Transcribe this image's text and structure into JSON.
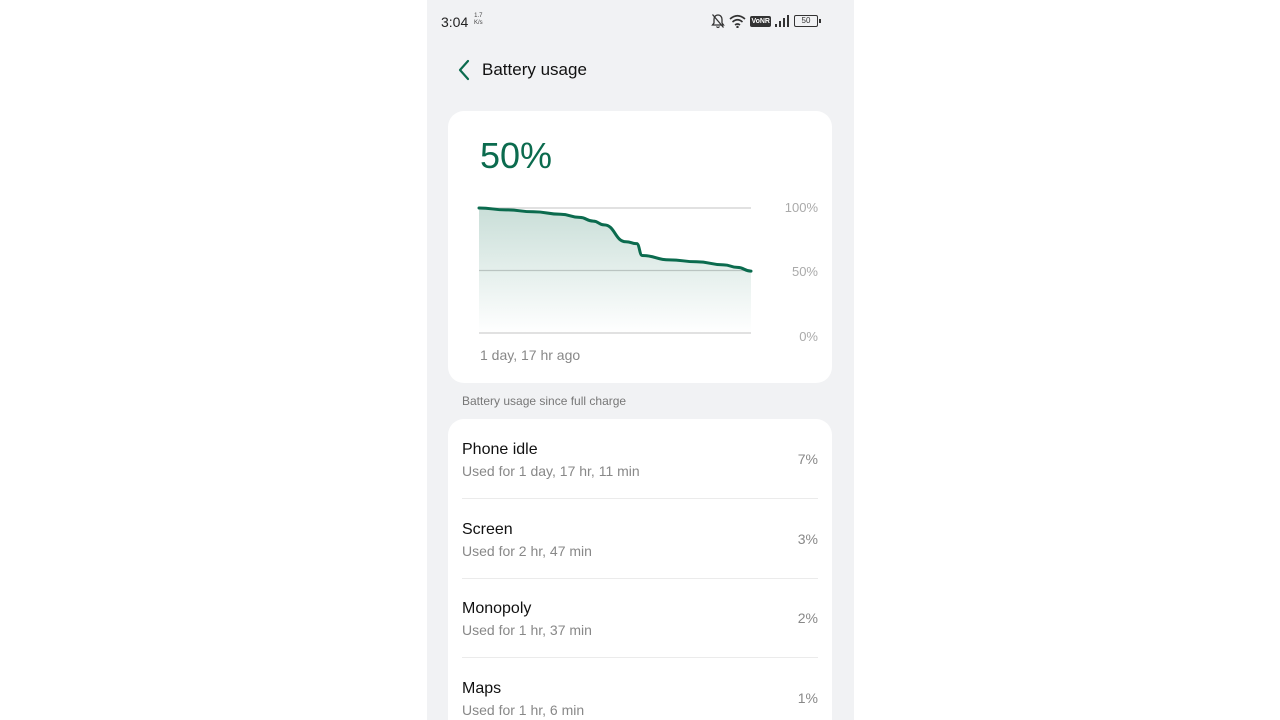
{
  "status_bar": {
    "time": "3:04",
    "speed_value": "1.7",
    "speed_unit": "K/s",
    "volte": "VoNR",
    "battery": "50"
  },
  "header": {
    "title": "Battery usage"
  },
  "summary": {
    "percent": "50%",
    "since": "1 day, 17 hr ago",
    "y_labels": [
      "100%",
      "50%",
      "0%"
    ]
  },
  "chart_data": {
    "type": "area",
    "x_label": "",
    "y_label": "",
    "ylim": [
      0,
      100
    ],
    "grid": true,
    "tick_labels": [
      "100%",
      "50%",
      "0%"
    ],
    "x_start_label": "1 day, 17 hr ago",
    "x": [
      0,
      0.1,
      0.2,
      0.3,
      0.37,
      0.42,
      0.46,
      0.54,
      0.58,
      0.6,
      0.7,
      0.8,
      0.9,
      0.95,
      1.0
    ],
    "values": [
      100,
      98.5,
      97,
      95,
      92.5,
      89.5,
      86.5,
      73,
      71.5,
      62,
      58.5,
      57,
      54.5,
      52.5,
      49.5
    ]
  },
  "section_label": "Battery usage since full charge",
  "apps": [
    {
      "name": "Phone idle",
      "usage": "Used for 1 day, 17 hr, 11 min",
      "percent": "7%"
    },
    {
      "name": "Screen",
      "usage": "Used for 2 hr, 47 min",
      "percent": "3%"
    },
    {
      "name": "Monopoly",
      "usage": "Used for 1 hr, 37 min",
      "percent": "2%"
    },
    {
      "name": "Maps",
      "usage": "Used for 1 hr, 6 min",
      "percent": "1%"
    }
  ],
  "colors": {
    "accent": "#0b6b4e",
    "background": "#f1f2f4",
    "card": "#ffffff"
  },
  "icons": [
    "back-arrow-icon",
    "bell-off-icon",
    "wifi-icon",
    "signal-icon",
    "battery-icon"
  ]
}
